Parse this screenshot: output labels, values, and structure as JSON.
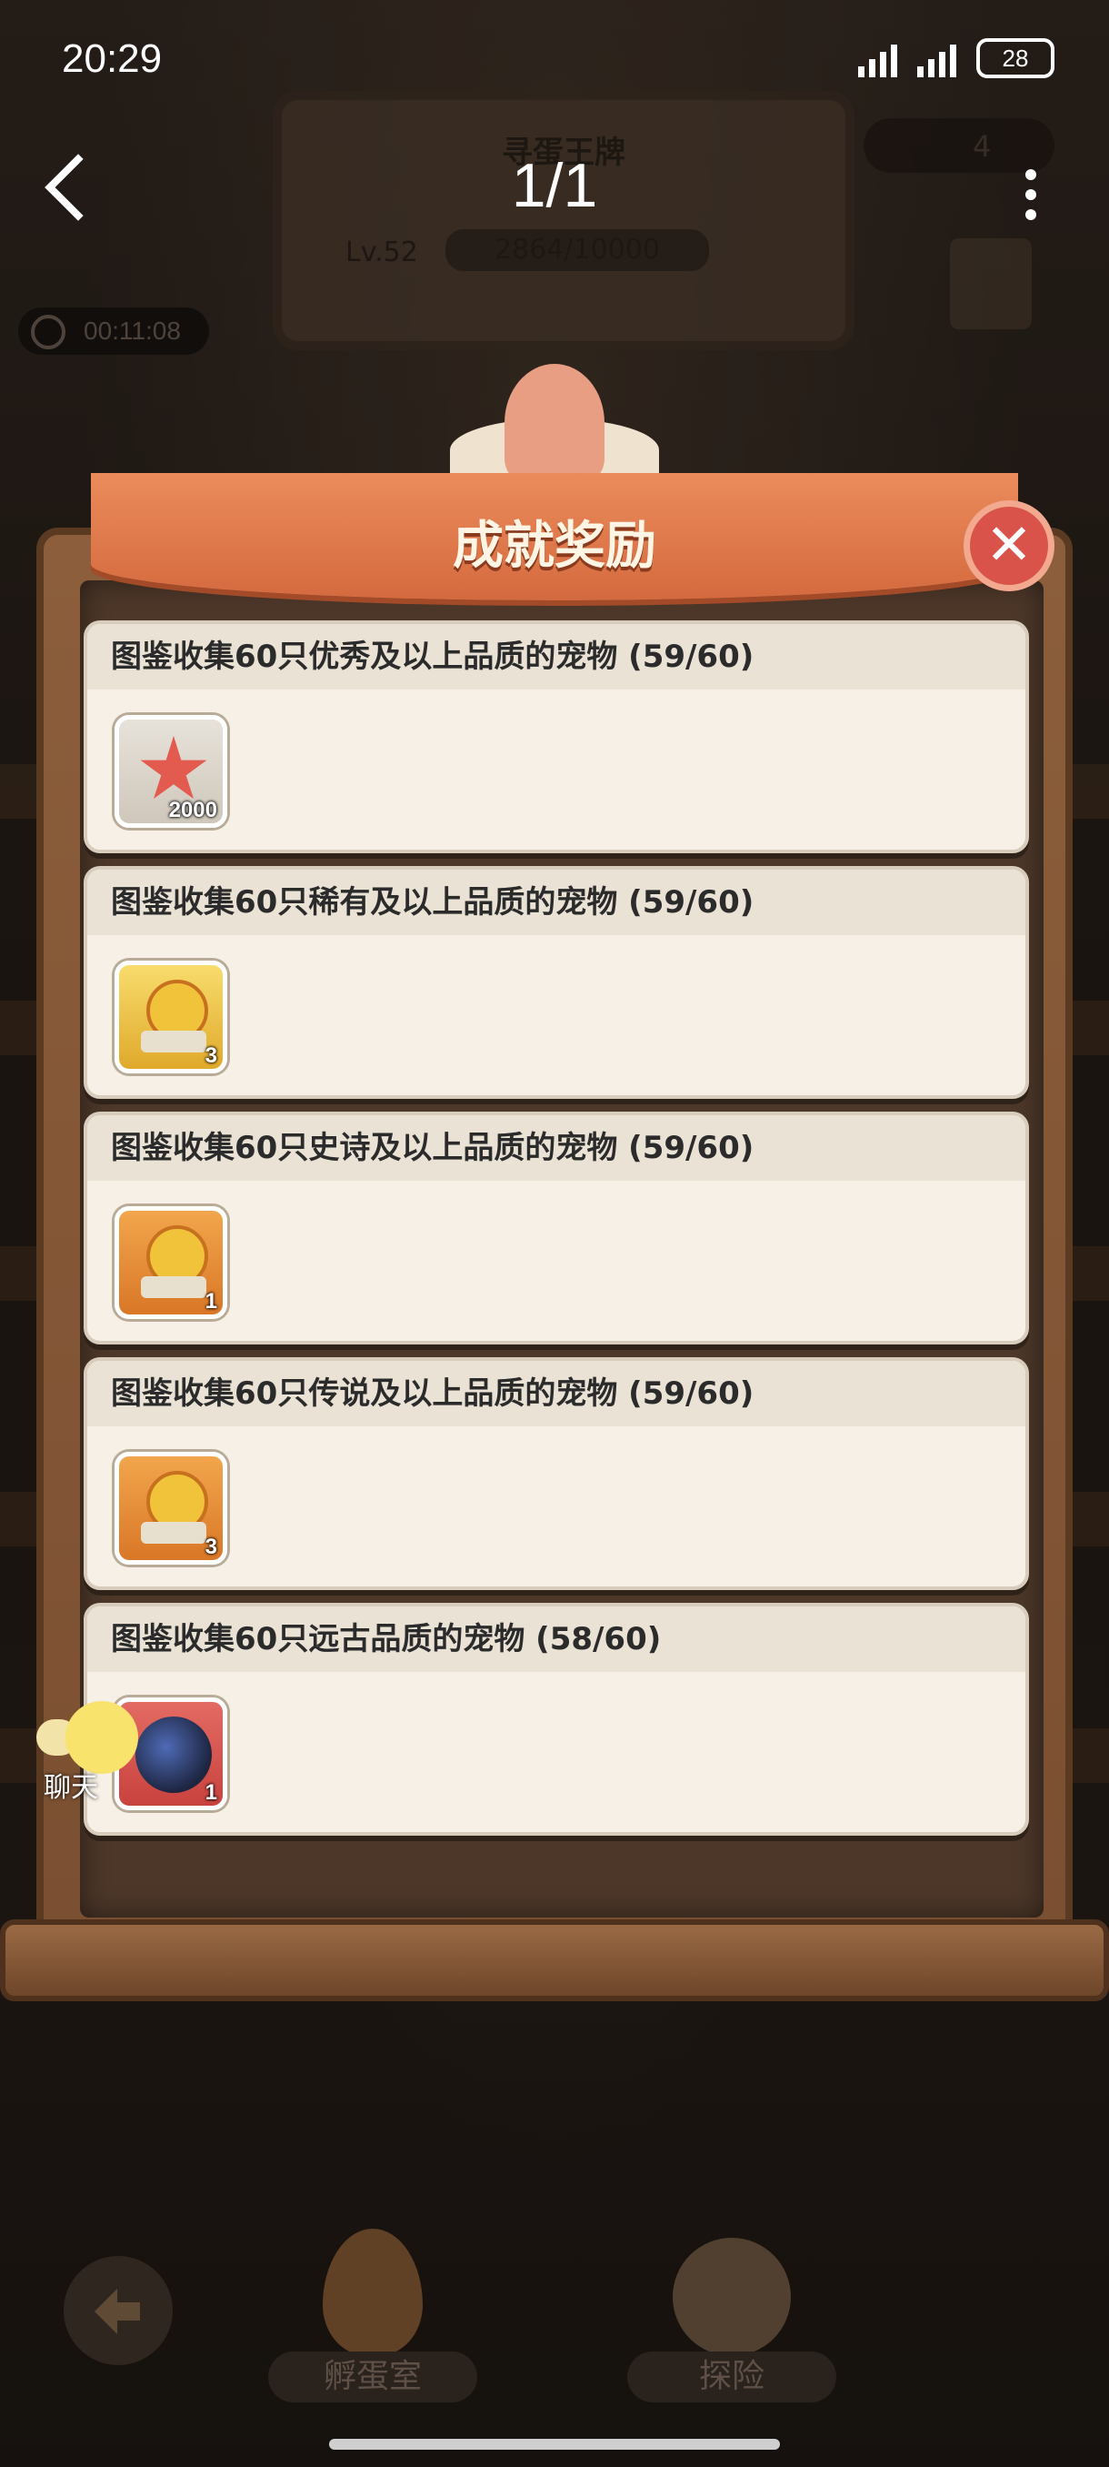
{
  "status_bar": {
    "time": "20:29",
    "battery": "28"
  },
  "top_bar": {
    "page_indicator": "1/1"
  },
  "background": {
    "sign_title": "寻蛋王牌",
    "level": "Lv.52",
    "xp": "2864/10000",
    "meat_count": "4",
    "timer": "00:11:08"
  },
  "dialog": {
    "title": "成就奖励",
    "items": [
      {
        "text": "图鉴收集60只优秀及以上品质的宠物 (59/60)",
        "reward_qty": "2000",
        "reward_icon": "starfish-icon"
      },
      {
        "text": "图鉴收集60只稀有及以上品质的宠物 (59/60)",
        "reward_qty": "3",
        "reward_icon": "lion-statue-icon"
      },
      {
        "text": "图鉴收集60只史诗及以上品质的宠物 (59/60)",
        "reward_qty": "1",
        "reward_icon": "lion-statue-icon"
      },
      {
        "text": "图鉴收集60只传说及以上品质的宠物 (59/60)",
        "reward_qty": "3",
        "reward_icon": "lion-statue-icon"
      },
      {
        "text": "图鉴收集60只远古品质的宠物 (58/60)",
        "reward_qty": "1",
        "reward_icon": "pet-portrait-icon"
      }
    ]
  },
  "chat": {
    "label": "聊天"
  },
  "bottom_nav": {
    "hatchery": "孵蛋室",
    "explore": "探险"
  }
}
